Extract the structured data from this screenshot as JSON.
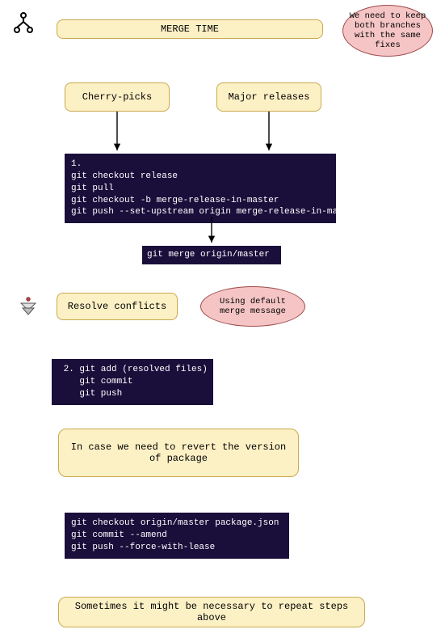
{
  "title": "MERGE TIME",
  "note_top": "We need to keep both branches with the same fixes",
  "source_left": "Cherry-picks",
  "source_right": "Major releases",
  "code1": "1.\ngit checkout release\ngit pull\ngit checkout -b merge-release-in-master\ngit push --set-upstream origin merge-release-in-master",
  "code_merge": "git merge origin/master",
  "resolve": "Resolve conflicts",
  "note_merge_msg": "Using default merge message",
  "code2": " 2. git add (resolved files)\n    git commit\n    git push",
  "revert_note": "In case we need to revert the version of package",
  "code3": "git checkout origin/master package.json\ngit commit --amend\ngit push --force-with-lease",
  "repeat_note": "Sometimes it might be necessary to repeat steps above",
  "icons": {
    "branch": "branch-icon",
    "down": "down-arrow-icon"
  }
}
